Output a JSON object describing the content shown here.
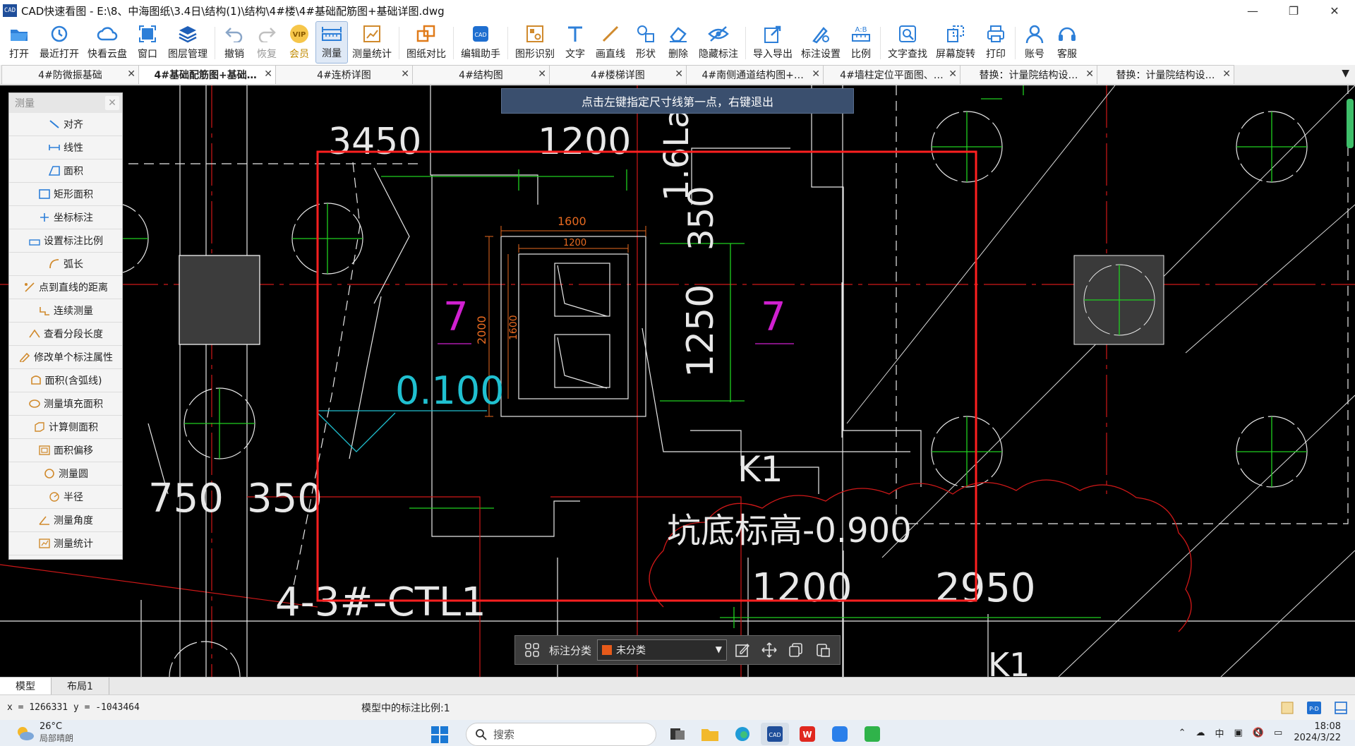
{
  "window": {
    "app_icon_text": "CAD",
    "title": "CAD快速看图 - E:\\8、中海图纸\\3.4日\\结构(1)\\结构\\4#楼\\4#基础配筋图+基础详图.dwg",
    "minimize": "—",
    "maximize": "❐",
    "close": "✕"
  },
  "ribbon": [
    {
      "label": "打开",
      "icon": "open-folder-icon"
    },
    {
      "label": "最近打开",
      "icon": "recent-clock-icon"
    },
    {
      "label": "快看云盘",
      "icon": "cloud-icon"
    },
    {
      "label": "窗口",
      "icon": "window-icon"
    },
    {
      "label": "图层管理",
      "icon": "layers-icon"
    },
    {
      "label": "撤销",
      "icon": "undo-icon"
    },
    {
      "label": "恢复",
      "icon": "redo-icon"
    },
    {
      "label": "会员",
      "icon": "vip-icon",
      "badge": "VIP"
    },
    {
      "label": "测量",
      "icon": "measure-ruler-icon"
    },
    {
      "label": "测量统计",
      "icon": "measure-stats-icon"
    },
    {
      "label": "图纸对比",
      "icon": "compare-icon"
    },
    {
      "label": "编辑助手",
      "icon": "edit-helper-icon"
    },
    {
      "label": "图形识别",
      "icon": "shape-recognize-icon"
    },
    {
      "label": "文字",
      "icon": "text-icon"
    },
    {
      "label": "画直线",
      "icon": "line-icon"
    },
    {
      "label": "形状",
      "icon": "shape-icon"
    },
    {
      "label": "删除",
      "icon": "eraser-icon"
    },
    {
      "label": "隐藏标注",
      "icon": "hide-eye-icon"
    },
    {
      "label": "导入导出",
      "icon": "import-export-icon"
    },
    {
      "label": "标注设置",
      "icon": "annotation-settings-icon"
    },
    {
      "label": "比例",
      "icon": "scale-icon"
    },
    {
      "label": "文字查找",
      "icon": "text-search-icon"
    },
    {
      "label": "屏幕旋转",
      "icon": "rotate-screen-icon"
    },
    {
      "label": "打印",
      "icon": "print-icon"
    },
    {
      "label": "账号",
      "icon": "account-icon"
    },
    {
      "label": "客服",
      "icon": "headset-icon"
    }
  ],
  "tabs": [
    {
      "label": "4#防微振基础",
      "close": "✕"
    },
    {
      "label": "4#基础配筋图+基础详图",
      "close": "✕"
    },
    {
      "label": "4#连桥详图",
      "close": "✕"
    },
    {
      "label": "4#结构图",
      "close": "✕"
    },
    {
      "label": "4#楼梯详图",
      "close": "✕"
    },
    {
      "label": "4#南侧通道结构图+地…",
      "close": "✕"
    },
    {
      "label": "4#墙柱定位平面图、…",
      "close": "✕"
    },
    {
      "label": "替换：计量院结构设…",
      "close": "✕"
    },
    {
      "label": "替换：计量院结构设…",
      "close": "✕"
    }
  ],
  "tab_dropdown": "▼",
  "hint": "点击左键指定尺寸线第一点，右键退出",
  "measure_panel": {
    "title": "测量",
    "close": "✕",
    "items": [
      {
        "label": "对齐",
        "icon": "align-measure-icon"
      },
      {
        "label": "线性",
        "icon": "linear-measure-icon"
      },
      {
        "label": "面积",
        "icon": "area-icon"
      },
      {
        "label": "矩形面积",
        "icon": "rect-area-icon"
      },
      {
        "label": "坐标标注",
        "icon": "coordinate-icon"
      },
      {
        "label": "设置标注比例",
        "icon": "set-scale-icon"
      },
      {
        "label": "弧长",
        "icon": "arc-length-icon"
      },
      {
        "label": "点到直线的距离",
        "icon": "point-line-distance-icon"
      },
      {
        "label": "连续测量",
        "icon": "continuous-measure-icon"
      },
      {
        "label": "查看分段长度",
        "icon": "segment-length-icon"
      },
      {
        "label": "修改单个标注属性",
        "icon": "edit-annotation-icon"
      },
      {
        "label": "面积(含弧线)",
        "icon": "arc-area-icon"
      },
      {
        "label": "测量填充面积",
        "icon": "fill-area-icon"
      },
      {
        "label": "计算侧面积",
        "icon": "side-area-icon"
      },
      {
        "label": "面积偏移",
        "icon": "area-offset-icon"
      },
      {
        "label": "测量圆",
        "icon": "circle-measure-icon"
      },
      {
        "label": "半径",
        "icon": "radius-icon"
      },
      {
        "label": "测量角度",
        "icon": "angle-icon"
      },
      {
        "label": "测量统计",
        "icon": "stats-icon"
      }
    ]
  },
  "drawing_text": {
    "t3450": "3450",
    "t1200_top": "1200",
    "t16la": "1.6La",
    "t350_r": "350",
    "t1600_a": "1600",
    "t1200_b": "1200",
    "t2000": "2000",
    "t1600_v": "1600",
    "t7_left": "7",
    "t7_right": "7",
    "t1250": "1250",
    "t0100": "0.100",
    "tk1_mid": "K1",
    "t750": "750",
    "t350_l": "350",
    "tpit": "坑底标高-0.900",
    "t1200_bot": "1200",
    "t2950": "2950",
    "tctl": "4-3#-CTL1",
    "tk1_bot": "K1"
  },
  "anno_bar": {
    "grid_icon": "grid-icon",
    "label": "标注分类",
    "selected": "未分类",
    "arrow": "▼",
    "category_color": "#e65a1a"
  },
  "layout_tabs": [
    {
      "label": "模型"
    },
    {
      "label": "布局1"
    }
  ],
  "status": {
    "coords": "x = 1266331  y = -1043464",
    "scale": "模型中的标注比例:1"
  },
  "taskbar": {
    "temp": "26°C",
    "weather_desc": "局部晴朗",
    "search": "搜索",
    "ime": "中",
    "time": "18:08",
    "date": "2024/3/22"
  }
}
